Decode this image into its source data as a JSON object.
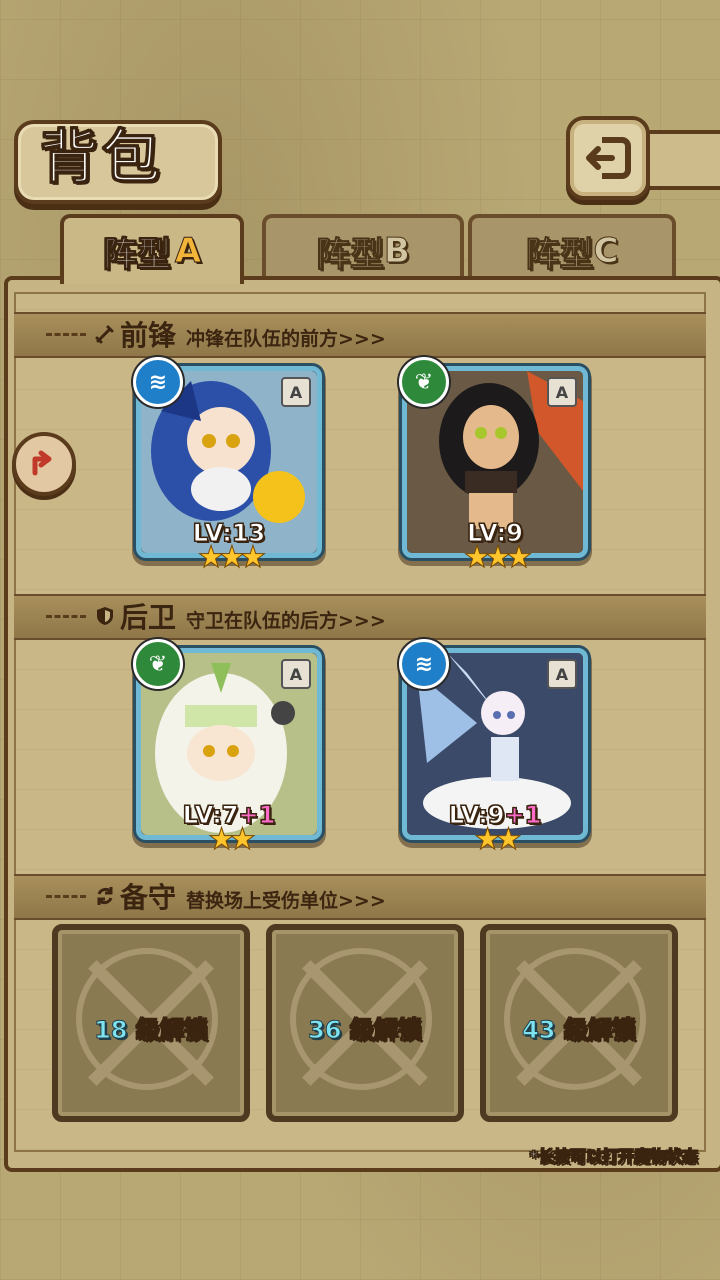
{
  "header": {
    "title": "背包"
  },
  "tabs": [
    {
      "label": "阵型",
      "letter": "A",
      "active": true
    },
    {
      "label": "阵型",
      "letter": "B",
      "active": false
    },
    {
      "label": "阵型",
      "letter": "C",
      "active": false
    }
  ],
  "sections": {
    "front": {
      "name": "前锋",
      "desc": "冲锋在队伍的前方>>>"
    },
    "back": {
      "name": "后卫",
      "desc": "守卫在队伍的后方>>>"
    },
    "reserve": {
      "name": "备守",
      "desc": "替换场上受伤单位>>>"
    }
  },
  "cards": [
    {
      "element": "water",
      "rank": "A",
      "level": "LV:13",
      "bonus": "",
      "stars": 3
    },
    {
      "element": "nature",
      "rank": "A",
      "level": "LV:9",
      "bonus": "",
      "stars": 3
    },
    {
      "element": "nature",
      "rank": "A",
      "level": "LV:7",
      "bonus": "+1",
      "stars": 2
    },
    {
      "element": "water",
      "rank": "A",
      "level": "LV:9",
      "bonus": "+1",
      "stars": 2
    }
  ],
  "locked_slots": [
    {
      "level": "18",
      "label": "级解锁"
    },
    {
      "level": "36",
      "label": "级解锁"
    },
    {
      "level": "43",
      "label": "级解锁"
    }
  ],
  "hint": "*长按可以打开魔物状态",
  "colors": {
    "water": "#1f7fc8",
    "nature": "#2e8a3a",
    "star": "#ffc52c",
    "bonus": "#ff6bc8",
    "unlock_level": "#7ee3f0"
  }
}
